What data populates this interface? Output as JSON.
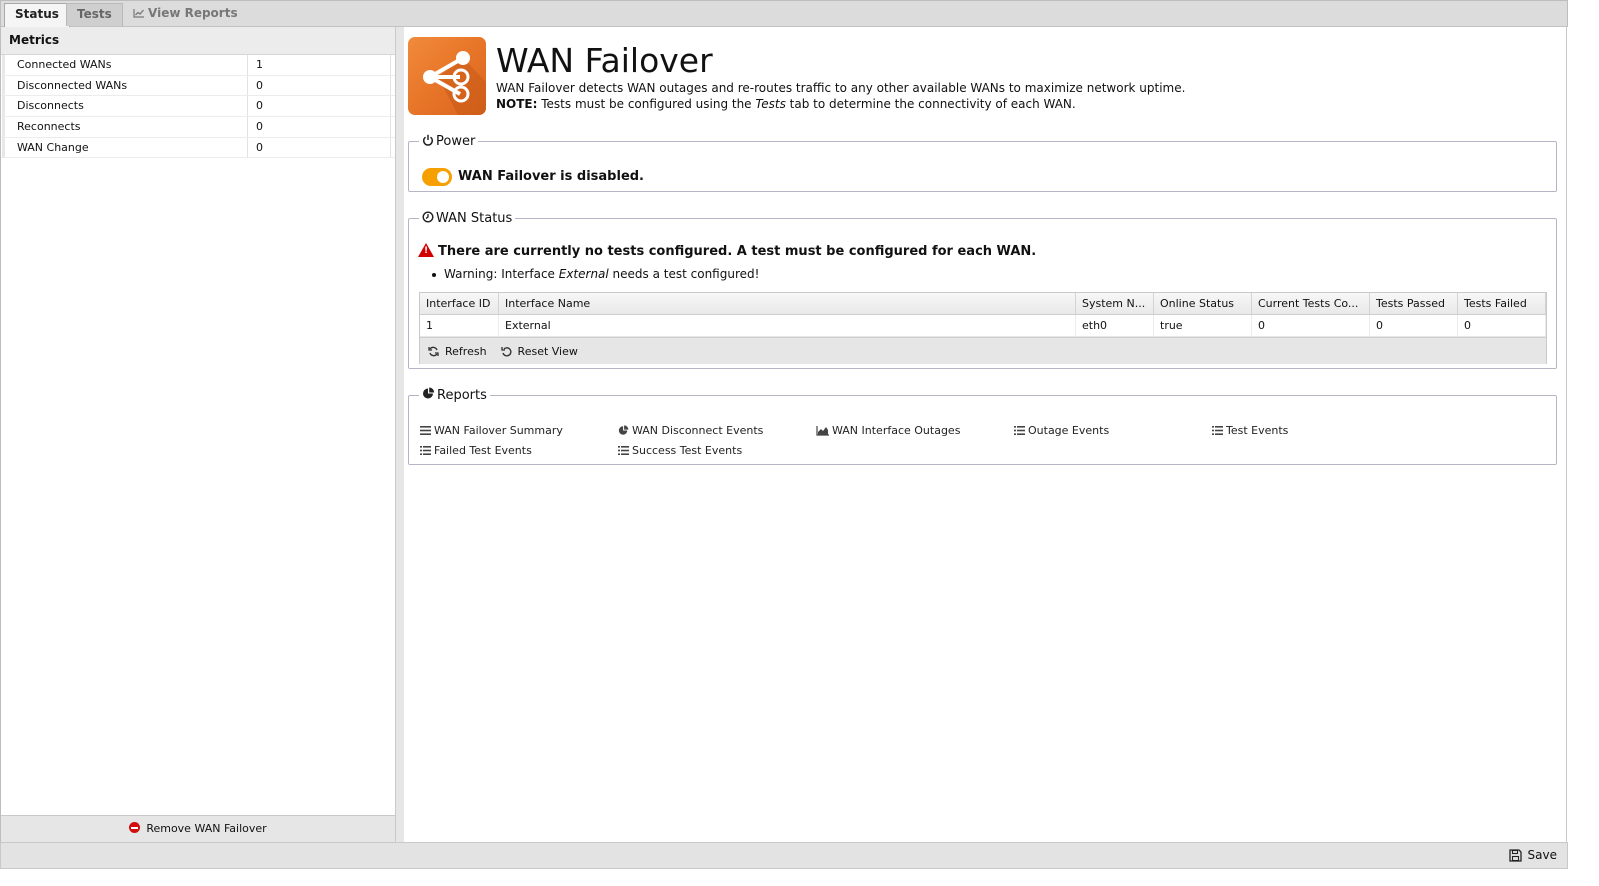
{
  "tabs": [
    {
      "label": "Status",
      "active": true
    },
    {
      "label": "Tests",
      "active": false
    },
    {
      "label": "View Reports",
      "active": false,
      "icon": "chart-line-icon"
    }
  ],
  "metrics": {
    "title": "Metrics",
    "rows": [
      {
        "name": "Connected WANs",
        "value": "1"
      },
      {
        "name": "Disconnected WANs",
        "value": "0"
      },
      {
        "name": "Disconnects",
        "value": "0"
      },
      {
        "name": "Reconnects",
        "value": "0"
      },
      {
        "name": "WAN Change",
        "value": "0"
      }
    ],
    "remove_label": "Remove WAN Failover"
  },
  "app": {
    "title": "WAN Failover",
    "description": "WAN Failover detects WAN outages and re-routes traffic to any other available WANs to maximize network uptime.",
    "note_label": "NOTE:",
    "note_pre": " Tests must be configured using the ",
    "note_em": "Tests",
    "note_post": " tab to determine the connectivity of each WAN."
  },
  "power": {
    "legend": "Power",
    "status_text": "WAN Failover is disabled.",
    "toggle_color": "#f5a000"
  },
  "wan_status": {
    "legend": "WAN Status",
    "warning": "There are currently no tests configured. A test must be configured for each WAN.",
    "item_pre": "Warning: Interface ",
    "item_em": "External",
    "item_post": " needs a test configured!",
    "columns": [
      "Interface ID",
      "Interface Name",
      "System N...",
      "Online Status",
      "Current Tests Co...",
      "Tests Passed",
      "Tests Failed"
    ],
    "rows": [
      [
        "1",
        "External",
        "eth0",
        "true",
        "0",
        "0",
        "0"
      ]
    ],
    "refresh_label": "Refresh",
    "reset_label": "Reset View"
  },
  "reports": {
    "legend": "Reports",
    "links": [
      {
        "label": "WAN Failover Summary",
        "icon": "list-icon"
      },
      {
        "label": "WAN Disconnect Events",
        "icon": "pie-chart-icon"
      },
      {
        "label": "WAN Interface Outages",
        "icon": "area-chart-icon"
      },
      {
        "label": "Outage Events",
        "icon": "list-icon"
      },
      {
        "label": "Test Events",
        "icon": "list-icon"
      },
      {
        "label": "Failed Test Events",
        "icon": "list-icon"
      },
      {
        "label": "Success Test Events",
        "icon": "list-icon"
      }
    ]
  },
  "footer": {
    "save_label": "Save"
  },
  "colors": {
    "accent": "#f5a000",
    "logo": "#e9772a",
    "danger": "#d01010"
  }
}
